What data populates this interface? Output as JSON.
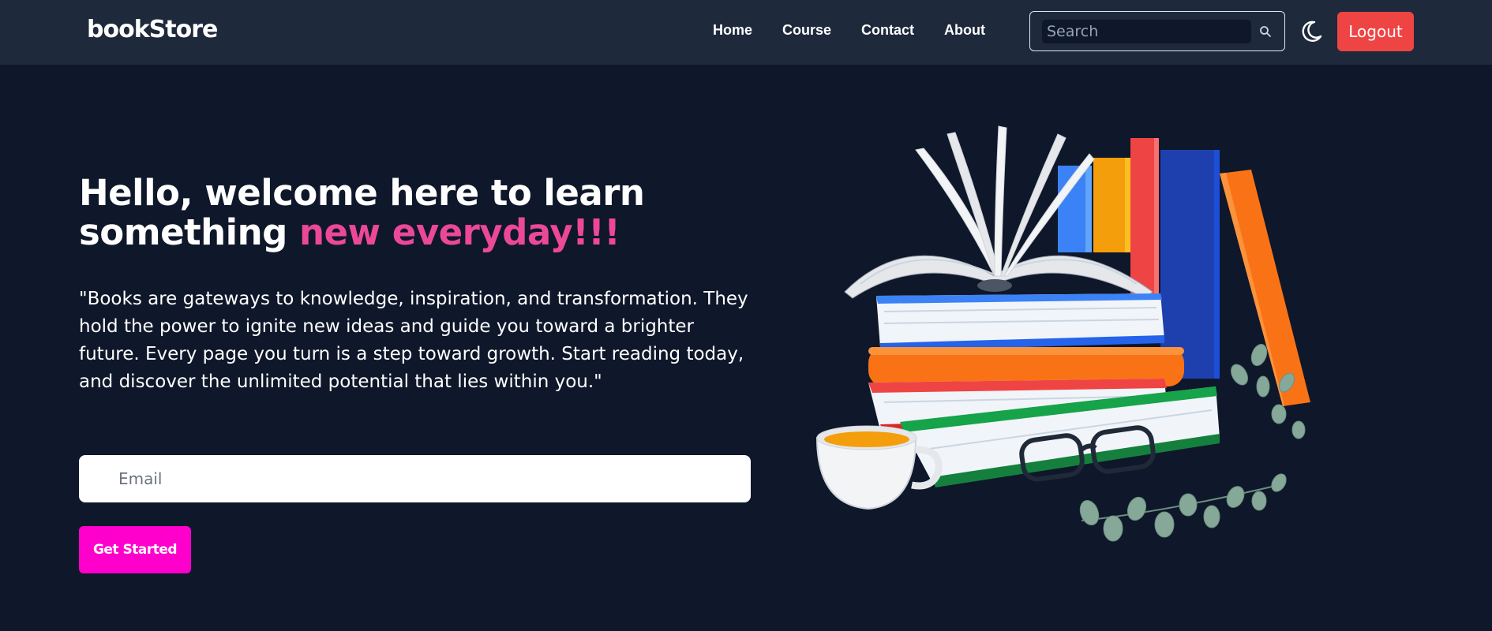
{
  "nav": {
    "brand": "bookStore",
    "links": [
      "Home",
      "Course",
      "Contact",
      "About"
    ],
    "search_placeholder": "Search",
    "search_icon": "search-icon",
    "theme_icon": "moon-icon",
    "logout_label": "Logout"
  },
  "hero": {
    "title_line1": "Hello, welcome here to learn",
    "title_line2_plain": "something ",
    "title_line2_accent": "new everyday!!!",
    "quote": "\"Books are gateways to knowledge, inspiration, and transformation. They hold the power to ignite new ideas and guide you toward a brighter future. Every page you turn is a step toward growth. Start reading today, and discover the unlimited potential that lies within you.\"",
    "email_placeholder": "Email",
    "cta_label": "Get Started"
  },
  "colors": {
    "background": "#0f172a",
    "navbar": "#1e293b",
    "accent": "#ec4899",
    "logout": "#ef4444",
    "cta": "#ff00cc"
  }
}
